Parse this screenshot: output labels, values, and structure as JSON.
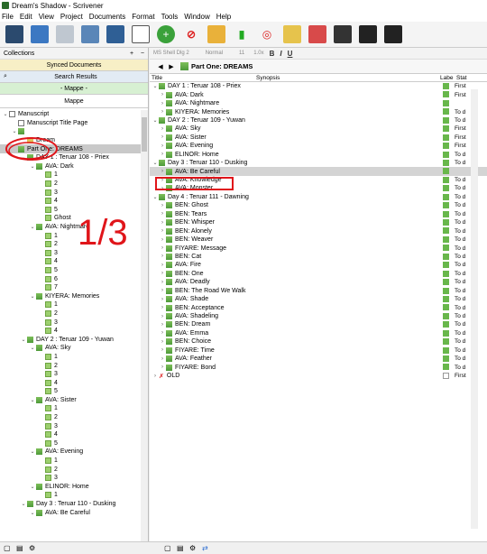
{
  "window": {
    "title": "Dream's Shadow - Scrivener"
  },
  "menu": [
    "File",
    "Edit",
    "View",
    "Project",
    "Documents",
    "Format",
    "Tools",
    "Window",
    "Help"
  ],
  "binder": {
    "collections_label": "Collections",
    "add": "+",
    "remove": "−",
    "synced": "Synced Documents",
    "search": "Search Results",
    "mappe_active": "- Mappe -",
    "mappe": "Mappe",
    "tree": [
      {
        "label": "Manuscript",
        "indent": 0,
        "arrow": "v",
        "icon": "doc"
      },
      {
        "label": "Manuscript Title Page",
        "indent": 1,
        "arrow": "",
        "icon": "doc"
      },
      {
        "label": "",
        "indent": 1,
        "arrow": "v",
        "icon": "chap"
      },
      {
        "label": "Dream",
        "indent": 2,
        "arrow": "",
        "icon": "folder"
      },
      {
        "label": "Part One: DREAMS",
        "indent": 1,
        "arrow": "",
        "icon": "chap",
        "selected": true
      },
      {
        "label": "DAY 1 : Teruar 108 - Priex",
        "indent": 2,
        "arrow": "v",
        "icon": "chap"
      },
      {
        "label": "AVA: Dark",
        "indent": 3,
        "arrow": "v",
        "icon": "chap"
      },
      {
        "label": "1",
        "indent": 4,
        "arrow": "",
        "icon": "scene"
      },
      {
        "label": "2",
        "indent": 4,
        "arrow": "",
        "icon": "scene"
      },
      {
        "label": "3",
        "indent": 4,
        "arrow": "",
        "icon": "scene"
      },
      {
        "label": "4",
        "indent": 4,
        "arrow": "",
        "icon": "scene"
      },
      {
        "label": "5",
        "indent": 4,
        "arrow": "",
        "icon": "scene"
      },
      {
        "label": "Ghost",
        "indent": 4,
        "arrow": "",
        "icon": "scene"
      },
      {
        "label": "AVA: Nightmare",
        "indent": 3,
        "arrow": "v",
        "icon": "chap"
      },
      {
        "label": "1",
        "indent": 4,
        "arrow": "",
        "icon": "scene"
      },
      {
        "label": "2",
        "indent": 4,
        "arrow": "",
        "icon": "scene"
      },
      {
        "label": "3",
        "indent": 4,
        "arrow": "",
        "icon": "scene"
      },
      {
        "label": "4",
        "indent": 4,
        "arrow": "",
        "icon": "scene"
      },
      {
        "label": "5",
        "indent": 4,
        "arrow": "",
        "icon": "scene"
      },
      {
        "label": "6",
        "indent": 4,
        "arrow": "",
        "icon": "scene"
      },
      {
        "label": "7",
        "indent": 4,
        "arrow": "",
        "icon": "scene"
      },
      {
        "label": "KIYERA: Memories",
        "indent": 3,
        "arrow": "v",
        "icon": "chap"
      },
      {
        "label": "1",
        "indent": 4,
        "arrow": "",
        "icon": "scene"
      },
      {
        "label": "2",
        "indent": 4,
        "arrow": "",
        "icon": "scene"
      },
      {
        "label": "3",
        "indent": 4,
        "arrow": "",
        "icon": "scene"
      },
      {
        "label": "4",
        "indent": 4,
        "arrow": "",
        "icon": "scene"
      },
      {
        "label": "DAY 2 : Teruar 109 - Yuwan",
        "indent": 2,
        "arrow": "v",
        "icon": "chap"
      },
      {
        "label": "AVA: Sky",
        "indent": 3,
        "arrow": "v",
        "icon": "chap"
      },
      {
        "label": "1",
        "indent": 4,
        "arrow": "",
        "icon": "scene"
      },
      {
        "label": "2",
        "indent": 4,
        "arrow": "",
        "icon": "scene"
      },
      {
        "label": "3",
        "indent": 4,
        "arrow": "",
        "icon": "scene"
      },
      {
        "label": "4",
        "indent": 4,
        "arrow": "",
        "icon": "scene"
      },
      {
        "label": "5",
        "indent": 4,
        "arrow": "",
        "icon": "scene"
      },
      {
        "label": "AVA: Sister",
        "indent": 3,
        "arrow": "v",
        "icon": "chap"
      },
      {
        "label": "1",
        "indent": 4,
        "arrow": "",
        "icon": "scene"
      },
      {
        "label": "2",
        "indent": 4,
        "arrow": "",
        "icon": "scene"
      },
      {
        "label": "3",
        "indent": 4,
        "arrow": "",
        "icon": "scene"
      },
      {
        "label": "4",
        "indent": 4,
        "arrow": "",
        "icon": "scene"
      },
      {
        "label": "5",
        "indent": 4,
        "arrow": "",
        "icon": "scene"
      },
      {
        "label": "AVA: Evening",
        "indent": 3,
        "arrow": "v",
        "icon": "chap"
      },
      {
        "label": "1",
        "indent": 4,
        "arrow": "",
        "icon": "scene"
      },
      {
        "label": "2",
        "indent": 4,
        "arrow": "",
        "icon": "scene"
      },
      {
        "label": "3",
        "indent": 4,
        "arrow": "",
        "icon": "scene"
      },
      {
        "label": "ELINOR: Home",
        "indent": 3,
        "arrow": "v",
        "icon": "chap"
      },
      {
        "label": "1",
        "indent": 4,
        "arrow": "",
        "icon": "scene"
      },
      {
        "label": "Day 3 : Teruar 110 - Dusking",
        "indent": 2,
        "arrow": "v",
        "icon": "chap"
      },
      {
        "label": "AVA: Be Careful",
        "indent": 3,
        "arrow": "v",
        "icon": "chap"
      }
    ]
  },
  "formatbar": {
    "style": "MS Shell Dlg 2",
    "paragraph": "Normal",
    "size": "11",
    "spacing": "1.0x",
    "bold": "B",
    "italic": "I",
    "underline": "U"
  },
  "outline": {
    "title": "Part One: DREAMS",
    "columns": {
      "title": "Title",
      "synopsis": "Synopsis",
      "label": "Labe",
      "status": "Stat"
    },
    "rows": [
      {
        "title": "DAY 1 : Teruar 108 - Priex",
        "indent": 0,
        "arrow": "v",
        "label": true,
        "status": "First"
      },
      {
        "title": "AVA: Dark",
        "indent": 1,
        "arrow": ">",
        "label": true,
        "status": "First"
      },
      {
        "title": "AVA: Nightmare",
        "indent": 1,
        "arrow": ">",
        "label": true,
        "status": ""
      },
      {
        "title": "KIYERA: Memories",
        "indent": 1,
        "arrow": ">",
        "label": true,
        "status": "To d"
      },
      {
        "title": "DAY 2 : Teruar 109 - Yuwan",
        "indent": 0,
        "arrow": "v",
        "label": true,
        "status": "To d"
      },
      {
        "title": "AVA: Sky",
        "indent": 1,
        "arrow": ">",
        "label": true,
        "status": "First"
      },
      {
        "title": "AVA: Sister",
        "indent": 1,
        "arrow": ">",
        "label": true,
        "status": "First"
      },
      {
        "title": "AVA: Evening",
        "indent": 1,
        "arrow": ">",
        "label": true,
        "status": "First"
      },
      {
        "title": "ELINOR: Home",
        "indent": 1,
        "arrow": ">",
        "label": true,
        "status": "To d"
      },
      {
        "title": "Day 3 : Teruar 110 - Dusking",
        "indent": 0,
        "arrow": "v",
        "label": true,
        "status": "To d"
      },
      {
        "title": "AVA: Be Careful",
        "indent": 1,
        "arrow": ">",
        "label": true,
        "status": "",
        "selected": true
      },
      {
        "title": "AVA: Knowledge",
        "indent": 1,
        "arrow": ">",
        "label": true,
        "status": "To d"
      },
      {
        "title": "AVA: Monster",
        "indent": 1,
        "arrow": ">",
        "label": true,
        "status": "To d"
      },
      {
        "title": "Day 4 : Teruar 111 - Dawning",
        "indent": 0,
        "arrow": "v",
        "label": true,
        "status": "To d"
      },
      {
        "title": "BEN: Ghost",
        "indent": 1,
        "arrow": ">",
        "label": true,
        "status": "To d"
      },
      {
        "title": "BEN: Tears",
        "indent": 1,
        "arrow": ">",
        "label": true,
        "status": "To d"
      },
      {
        "title": "BEN: Whisper",
        "indent": 1,
        "arrow": ">",
        "label": true,
        "status": "To d"
      },
      {
        "title": "BEN: Alonely",
        "indent": 1,
        "arrow": ">",
        "label": true,
        "status": "To d"
      },
      {
        "title": "BEN: Weaver",
        "indent": 1,
        "arrow": ">",
        "label": true,
        "status": "To d"
      },
      {
        "title": "FIYARE: Message",
        "indent": 1,
        "arrow": ">",
        "label": true,
        "status": "To d"
      },
      {
        "title": "BEN: Cat",
        "indent": 1,
        "arrow": ">",
        "label": true,
        "status": "To d"
      },
      {
        "title": "AVA: Fire",
        "indent": 1,
        "arrow": ">",
        "label": true,
        "status": "To d"
      },
      {
        "title": "BEN: One",
        "indent": 1,
        "arrow": ">",
        "label": true,
        "status": "To d"
      },
      {
        "title": "AVA: Deadly",
        "indent": 1,
        "arrow": ">",
        "label": true,
        "status": "To d"
      },
      {
        "title": "BEN: The Road We Walk",
        "indent": 1,
        "arrow": ">",
        "label": true,
        "status": "To d"
      },
      {
        "title": "AVA: Shade",
        "indent": 1,
        "arrow": ">",
        "label": true,
        "status": "To d"
      },
      {
        "title": "BEN: Acceptance",
        "indent": 1,
        "arrow": ">",
        "label": true,
        "status": "To d"
      },
      {
        "title": "AVA: Shadeling",
        "indent": 1,
        "arrow": ">",
        "label": true,
        "status": "To d"
      },
      {
        "title": "BEN: Dream",
        "indent": 1,
        "arrow": ">",
        "label": true,
        "status": "To d"
      },
      {
        "title": "AVA: Emma",
        "indent": 1,
        "arrow": ">",
        "label": true,
        "status": "To d"
      },
      {
        "title": "BEN: Choice",
        "indent": 1,
        "arrow": ">",
        "label": true,
        "status": "To d"
      },
      {
        "title": "FIYARE: Time",
        "indent": 1,
        "arrow": ">",
        "label": true,
        "status": "To d"
      },
      {
        "title": "AVA: Feather",
        "indent": 1,
        "arrow": ">",
        "label": true,
        "status": "To d"
      },
      {
        "title": "FIYARE: Bond",
        "indent": 1,
        "arrow": ">",
        "label": true,
        "status": "To d"
      },
      {
        "title": "OLD",
        "indent": 0,
        "arrow": ">",
        "label": false,
        "status": "First",
        "icon": "x"
      }
    ]
  },
  "annotation": {
    "text": "1/3",
    "color": "#e0151a"
  },
  "colors": {
    "label_green": "#68b74b",
    "highlight_red": "#e0151a"
  }
}
